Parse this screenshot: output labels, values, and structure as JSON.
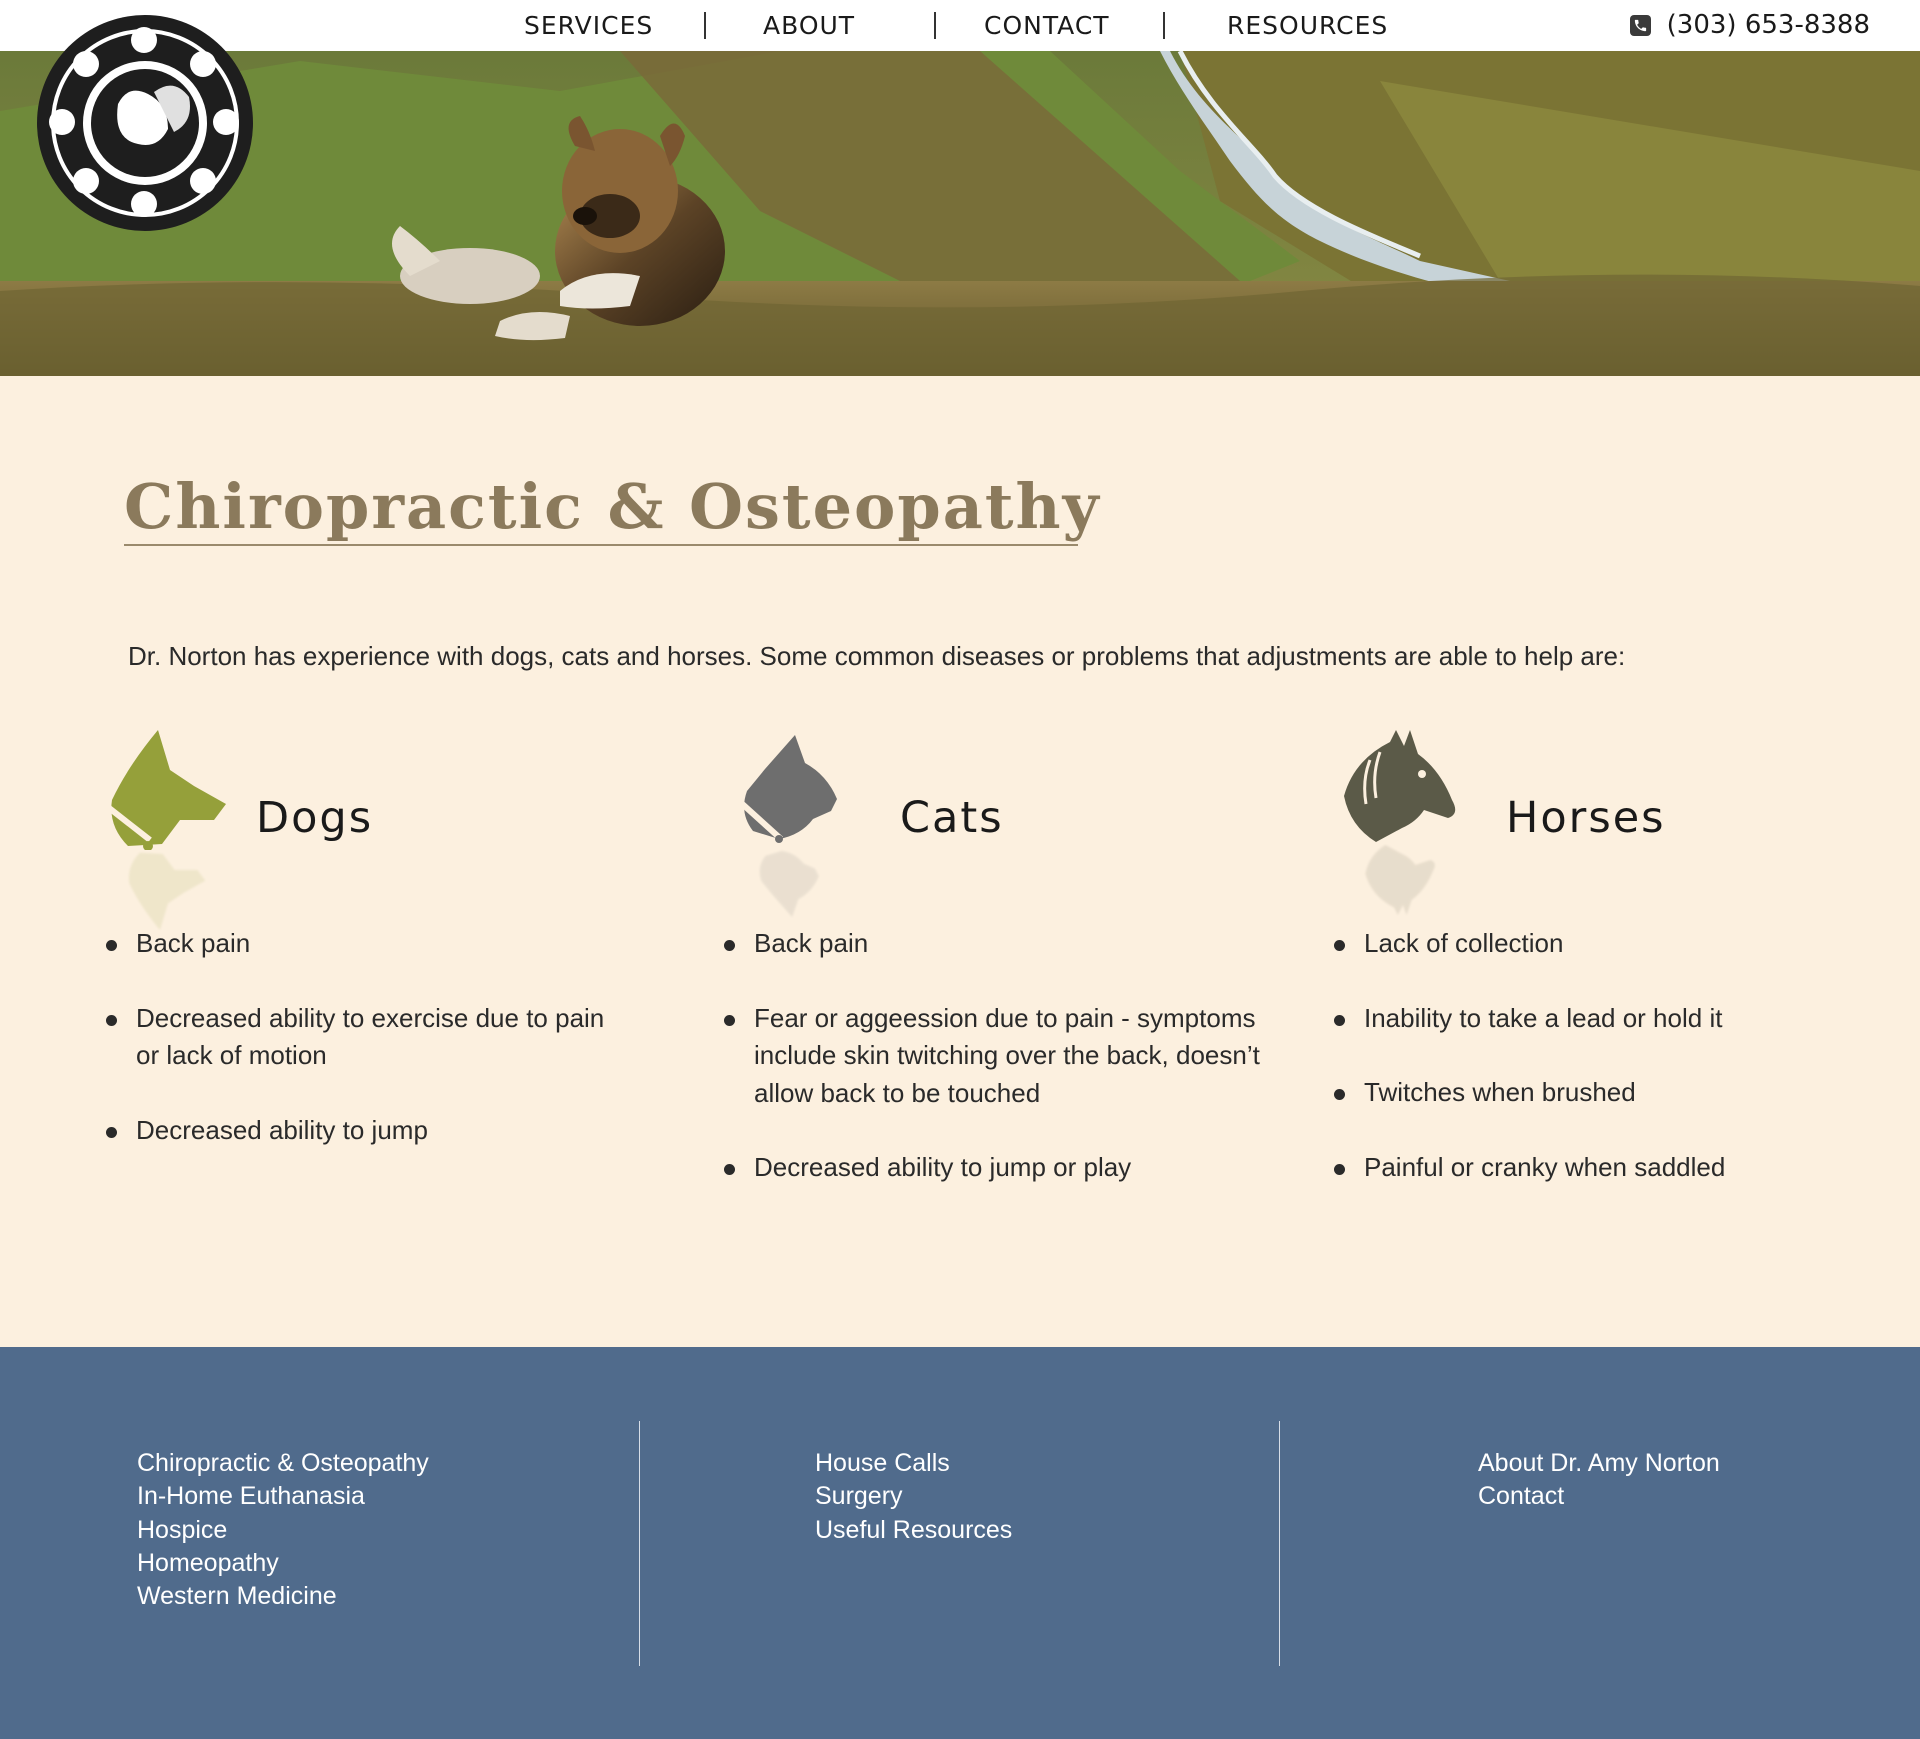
{
  "nav": {
    "items": [
      {
        "label": "SERVICES"
      },
      {
        "label": "ABOUT"
      },
      {
        "label": "CONTACT"
      },
      {
        "label": "RESOURCES"
      }
    ],
    "phone": "(303) 653-8388",
    "phone_icon": "phone-icon"
  },
  "hero": {
    "image": "dog-lying-on-mountain-hillside-with-river",
    "logo_icon": "animal-circle-logo"
  },
  "main": {
    "title": "Chiropractic & Osteopathy",
    "intro": "Dr. Norton has experience with dogs, cats and horses. Some common diseases or problems that adjustments are able to help are:",
    "columns": [
      {
        "title": "Dogs",
        "icon": "dog-head-icon",
        "icon_color": "#95a03a",
        "items": [
          "Back pain",
          "Decreased ability to exercise due to pain or lack of motion",
          "Decreased ability to jump"
        ]
      },
      {
        "title": "Cats",
        "icon": "cat-head-icon",
        "icon_color": "#6e6e6e",
        "items": [
          "Back pain",
          "Fear or aggeession due to pain - symptoms include skin twitching over the back, doesn’t allow back to be touched",
          "Decreased ability to jump or play"
        ]
      },
      {
        "title": "Horses",
        "icon": "horse-head-icon",
        "icon_color": "#5b5a48",
        "items": [
          "Lack of collection",
          "Inability to take a lead or hold it",
          "Twitches when brushed",
          "Painful or cranky when saddled"
        ]
      }
    ]
  },
  "footer": {
    "background": "#506b8c",
    "columns": [
      {
        "links": [
          "Chiropractic & Osteopathy",
          "In-Home Euthanasia",
          "Hospice",
          "Homeopathy",
          "Western Medicine"
        ]
      },
      {
        "links": [
          "House Calls",
          "Surgery",
          "Useful Resources"
        ]
      },
      {
        "links": [
          "About Dr. Amy Norton",
          "Contact"
        ]
      }
    ]
  }
}
